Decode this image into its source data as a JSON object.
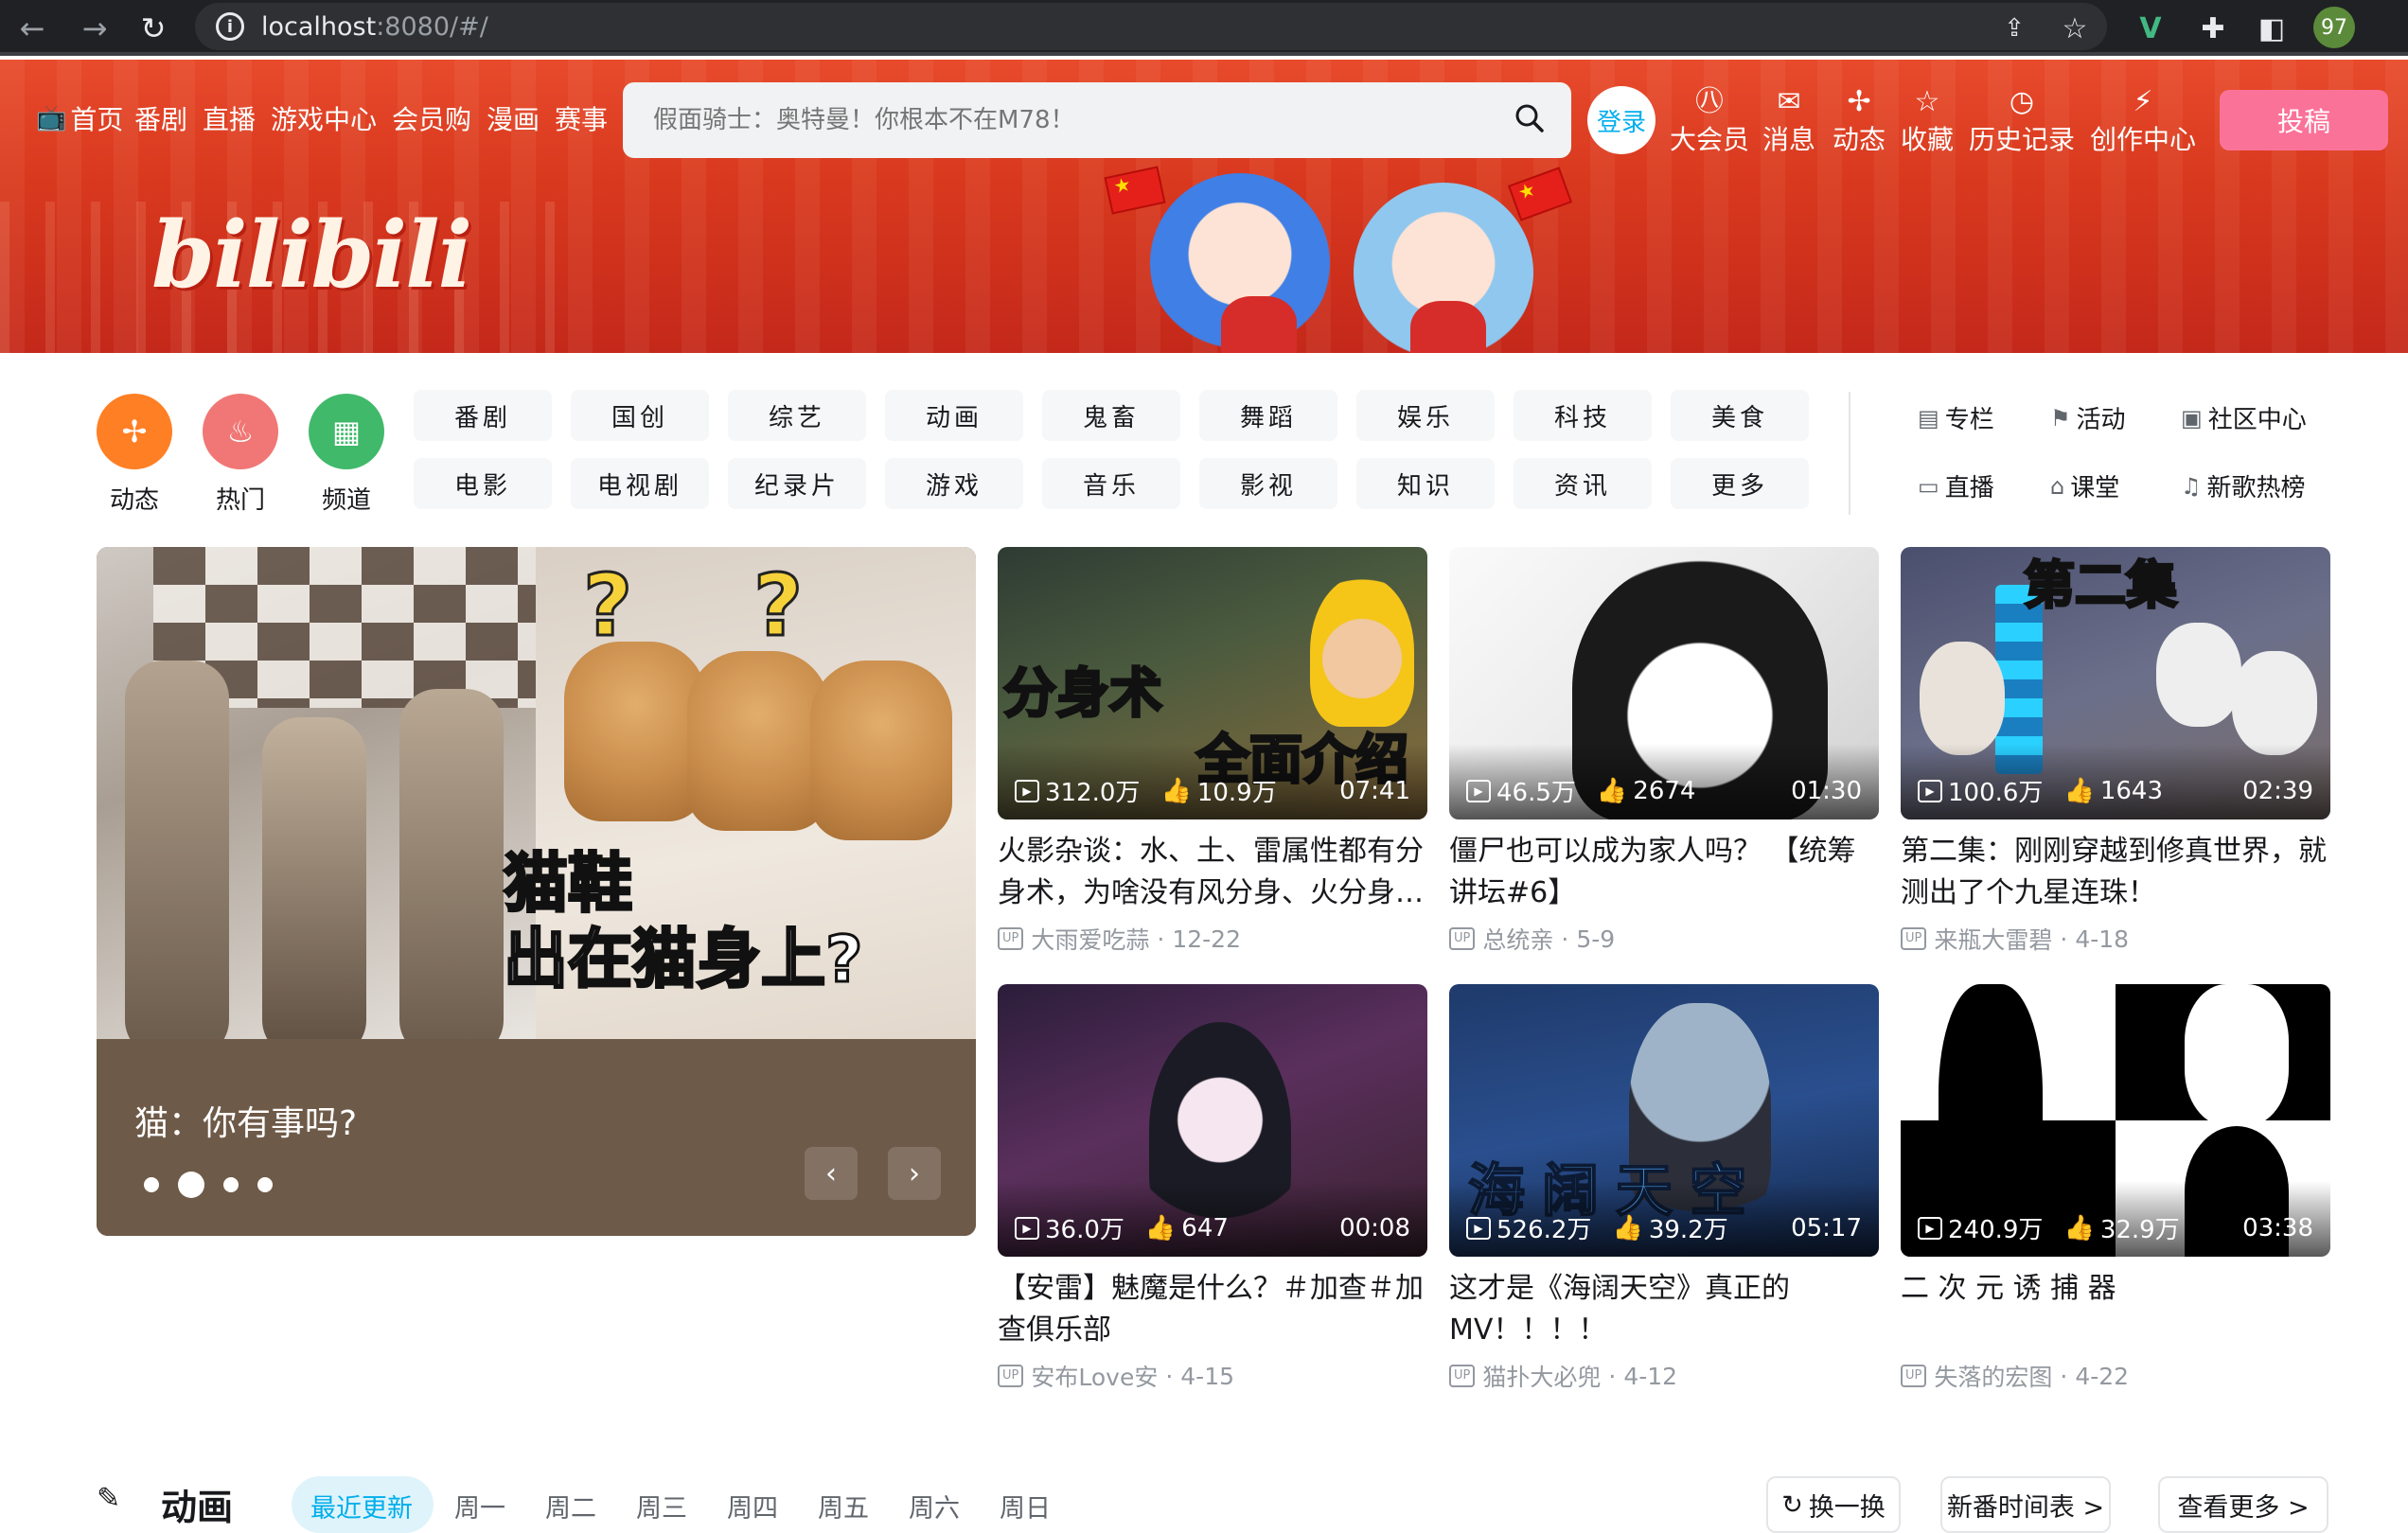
{
  "browser": {
    "url_host": "localhost",
    "url_path": ":8080/#/",
    "ext_badge": "97"
  },
  "header": {
    "nav": [
      {
        "label": "首页"
      },
      {
        "label": "番剧"
      },
      {
        "label": "直播"
      },
      {
        "label": "游戏中心"
      },
      {
        "label": "会员购"
      },
      {
        "label": "漫画"
      },
      {
        "label": "赛事"
      }
    ],
    "search_placeholder": "假面骑士：奥特曼！你根本不在M78！",
    "login_label": "登录",
    "icons": [
      {
        "label": "大会员",
        "icon": "vip-icon"
      },
      {
        "label": "消息",
        "icon": "mail-icon"
      },
      {
        "label": "动态",
        "icon": "pinwheel-icon"
      },
      {
        "label": "收藏",
        "icon": "star-icon"
      },
      {
        "label": "历史记录",
        "icon": "clock-icon"
      },
      {
        "label": "创作中心",
        "icon": "bolt-icon"
      }
    ],
    "upload_label": "投稿",
    "logo_text": "bilibili"
  },
  "quick": [
    {
      "label": "动态",
      "color": "#ff7f24"
    },
    {
      "label": "热门",
      "color": "#f07775"
    },
    {
      "label": "频道",
      "color": "#40b96a"
    }
  ],
  "channels": [
    [
      "番剧",
      "国创",
      "综艺",
      "动画",
      "鬼畜",
      "舞蹈",
      "娱乐",
      "科技",
      "美食"
    ],
    [
      "电影",
      "电视剧",
      "纪录片",
      "游戏",
      "音乐",
      "影视",
      "知识",
      "资讯",
      "更多"
    ]
  ],
  "side_links": [
    {
      "label": "专栏",
      "icon": "column-icon"
    },
    {
      "label": "活动",
      "icon": "flag-icon"
    },
    {
      "label": "社区中心",
      "icon": "community-icon"
    },
    {
      "label": "直播",
      "icon": "live-icon"
    },
    {
      "label": "课堂",
      "icon": "classroom-icon"
    },
    {
      "label": "新歌热榜",
      "icon": "music-icon"
    }
  ],
  "carousel": {
    "title": "猫：你有事吗?",
    "caption_top": "猫鞋",
    "caption_bottom": "出在猫身上?",
    "slides": 4,
    "active": 1
  },
  "videos": [
    {
      "title": "火影杂谈：水、土、雷属性都有分身术，为啥没有风分身、火分身…",
      "views": "312.0万",
      "likes": "10.9万",
      "duration": "07:41",
      "author": "大雨爱吃蒜",
      "date": "12-22",
      "thumb_text1": "分身术",
      "thumb_text2": "全面介绍"
    },
    {
      "title": "僵尸也可以成为家人吗？ 【统筹讲坛#6】",
      "views": "46.5万",
      "likes": "2674",
      "duration": "01:30",
      "author": "总统亲",
      "date": "5-9"
    },
    {
      "title": "第二集：刚刚穿越到修真世界，就测出了个九星连珠！",
      "views": "100.6万",
      "likes": "1643",
      "duration": "02:39",
      "author": "来瓶大雷碧",
      "date": "4-18",
      "thumb_text1": "第二集"
    },
    {
      "title": "【安雷】魅魔是什么？＃加查＃加查俱乐部",
      "views": "36.0万",
      "likes": "647",
      "duration": "00:08",
      "author": "安布Love安",
      "date": "4-15"
    },
    {
      "title": "这才是《海阔天空》真正的MV！！！！",
      "views": "526.2万",
      "likes": "39.2万",
      "duration": "05:17",
      "author": "猫扑大必兜",
      "date": "4-12",
      "thumb_text1": "海阔天空"
    },
    {
      "title": "二 次 元 诱 捕 器",
      "views": "240.9万",
      "likes": "32.9万",
      "duration": "03:38",
      "author": "失落的宏图",
      "date": "4-22"
    }
  ],
  "up_badge": "UP",
  "meta_sep": "·",
  "section": {
    "title": "动画",
    "tabs": [
      "最近更新",
      "周一",
      "周二",
      "周三",
      "周四",
      "周五",
      "周六",
      "周日"
    ],
    "buttons": [
      "换一换",
      "新番时间表 >",
      "查看更多 >"
    ]
  }
}
